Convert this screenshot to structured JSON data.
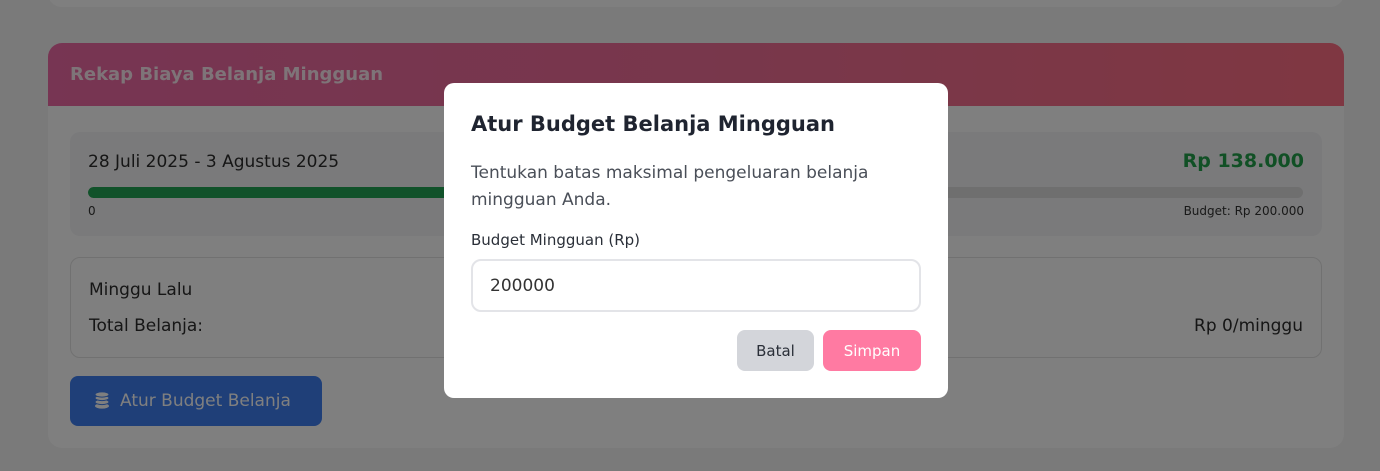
{
  "card": {
    "title": "Rekap Biaya Belanja Mingguan"
  },
  "current_week": {
    "range": "28 Juli 2025 - 3 Agustus 2025",
    "amount": "Rp 138.000",
    "progress_fraction": 0.69,
    "min_label": "0",
    "budget_label": "Budget: Rp 200.000"
  },
  "last_week": {
    "title": "Minggu Lalu",
    "total_label": "Total Belanja:",
    "total_value": "Rp 0/minggu"
  },
  "budget_button": {
    "label": "Atur Budget Belanja",
    "icon": "coins-icon"
  },
  "modal": {
    "title": "Atur Budget Belanja Mingguan",
    "description": "Tentukan batas maksimal pengeluaran belanja mingguan Anda.",
    "field_label": "Budget Mingguan (Rp)",
    "field_value": "200000",
    "cancel_label": "Batal",
    "save_label": "Simpan"
  },
  "colors": {
    "header_gradient_start": "#ee6aa6",
    "header_gradient_end": "#ff6f84",
    "progress": "#23a455",
    "amount": "#22a04b",
    "primary_button": "#3f7ff0",
    "save_button": "#ff7aa2",
    "cancel_button": "#d3d5da"
  }
}
